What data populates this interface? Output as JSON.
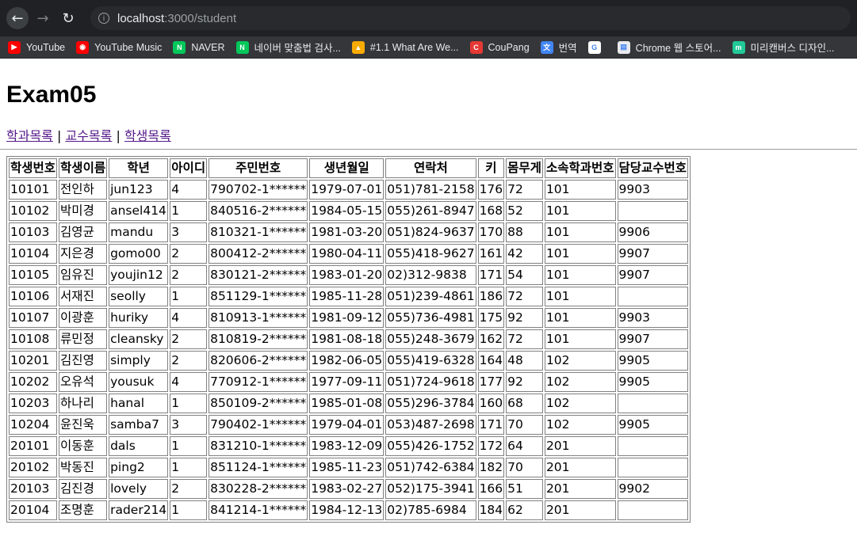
{
  "browser": {
    "url_host": "localhost",
    "url_rest": ":3000/student",
    "bookmarks": [
      {
        "label": "YouTube",
        "icon": "youtube-icon",
        "color": "#ff0000",
        "glyph": "▶"
      },
      {
        "label": "YouTube Music",
        "icon": "youtube-music-icon",
        "color": "#ff0000",
        "glyph": "◉"
      },
      {
        "label": "NAVER",
        "icon": "naver-icon",
        "color": "#03c75a",
        "glyph": "N"
      },
      {
        "label": "네이버 맞춤법 검사...",
        "icon": "naver-icon",
        "color": "#03c75a",
        "glyph": "N"
      },
      {
        "label": "#1.1 What Are We...",
        "icon": "warning-icon",
        "color": "#f9ab00",
        "glyph": "▲"
      },
      {
        "label": "CouPang",
        "icon": "coupang-icon",
        "color": "#e53935",
        "glyph": "C"
      },
      {
        "label": "번역",
        "icon": "translate-icon",
        "color": "#4285f4",
        "glyph": "文"
      },
      {
        "label": "",
        "icon": "google-icon",
        "color": "#ffffff",
        "glyph": "G"
      },
      {
        "label": "Chrome 웹 스토어...",
        "icon": "chrome-webstore-icon",
        "color": "#e8eaed",
        "glyph": "▤"
      },
      {
        "label": "미리캔버스 디자인...",
        "icon": "miricanvas-icon",
        "color": "#20c997",
        "glyph": "m"
      }
    ]
  },
  "page": {
    "title": "Exam05",
    "nav_links": [
      "학과목록",
      "교수목록",
      "학생목록"
    ],
    "separator": "|"
  },
  "table": {
    "headers": [
      "학생번호",
      "학생이름",
      "학년",
      "아이디",
      "주민번호",
      "생년월일",
      "연락처",
      "키",
      "몸무게",
      "소속학과번호",
      "담당교수번호"
    ],
    "rows": [
      [
        "10101",
        "전인하",
        "jun123",
        "4",
        "790702-1******",
        "1979-07-01",
        "051)781-2158",
        "176",
        "72",
        "101",
        "9903"
      ],
      [
        "10102",
        "박미경",
        "ansel414",
        "1",
        "840516-2******",
        "1984-05-15",
        "055)261-8947",
        "168",
        "52",
        "101",
        ""
      ],
      [
        "10103",
        "김영균",
        "mandu",
        "3",
        "810321-1******",
        "1981-03-20",
        "051)824-9637",
        "170",
        "88",
        "101",
        "9906"
      ],
      [
        "10104",
        "지은경",
        "gomo00",
        "2",
        "800412-2******",
        "1980-04-11",
        "055)418-9627",
        "161",
        "42",
        "101",
        "9907"
      ],
      [
        "10105",
        "임유진",
        "youjin12",
        "2",
        "830121-2******",
        "1983-01-20",
        "02)312-9838",
        "171",
        "54",
        "101",
        "9907"
      ],
      [
        "10106",
        "서재진",
        "seolly",
        "1",
        "851129-1******",
        "1985-11-28",
        "051)239-4861",
        "186",
        "72",
        "101",
        ""
      ],
      [
        "10107",
        "이광훈",
        "huriky",
        "4",
        "810913-1******",
        "1981-09-12",
        "055)736-4981",
        "175",
        "92",
        "101",
        "9903"
      ],
      [
        "10108",
        "류민정",
        "cleansky",
        "2",
        "810819-2******",
        "1981-08-18",
        "055)248-3679",
        "162",
        "72",
        "101",
        "9907"
      ],
      [
        "10201",
        "김진영",
        "simply",
        "2",
        "820606-2******",
        "1982-06-05",
        "055)419-6328",
        "164",
        "48",
        "102",
        "9905"
      ],
      [
        "10202",
        "오유석",
        "yousuk",
        "4",
        "770912-1******",
        "1977-09-11",
        "051)724-9618",
        "177",
        "92",
        "102",
        "9905"
      ],
      [
        "10203",
        "하나리",
        "hanal",
        "1",
        "850109-2******",
        "1985-01-08",
        "055)296-3784",
        "160",
        "68",
        "102",
        ""
      ],
      [
        "10204",
        "윤진욱",
        "samba7",
        "3",
        "790402-1******",
        "1979-04-01",
        "053)487-2698",
        "171",
        "70",
        "102",
        "9905"
      ],
      [
        "20101",
        "이동훈",
        "dals",
        "1",
        "831210-1******",
        "1983-12-09",
        "055)426-1752",
        "172",
        "64",
        "201",
        ""
      ],
      [
        "20102",
        "박동진",
        "ping2",
        "1",
        "851124-1******",
        "1985-11-23",
        "051)742-6384",
        "182",
        "70",
        "201",
        ""
      ],
      [
        "20103",
        "김진경",
        "lovely",
        "2",
        "830228-2******",
        "1983-02-27",
        "052)175-3941",
        "166",
        "51",
        "201",
        "9902"
      ],
      [
        "20104",
        "조명훈",
        "rader214",
        "1",
        "841214-1******",
        "1984-12-13",
        "02)785-6984",
        "184",
        "62",
        "201",
        ""
      ]
    ]
  }
}
